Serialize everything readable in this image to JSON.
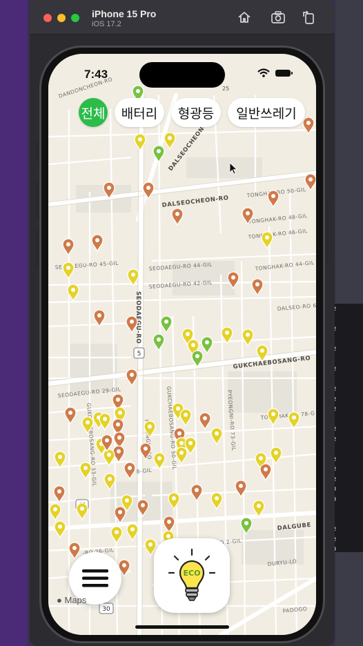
{
  "simulator": {
    "device_name": "iPhone 15 Pro",
    "os_version": "iOS 17.2",
    "toolbar_icons": [
      "home-icon",
      "screenshot-icon",
      "rotate-icon"
    ]
  },
  "status_bar": {
    "time": "7:43"
  },
  "filters": {
    "items": [
      {
        "label": "전체",
        "active": true
      },
      {
        "label": "배터리",
        "active": false
      },
      {
        "label": "형광등",
        "active": false
      },
      {
        "label": "일반쓰레기",
        "active": false
      }
    ]
  },
  "map": {
    "attribution": "Maps",
    "road_labels": {
      "dalseocheon": "DALSEOCHEON-RO",
      "dalseocheon2": "DALSEOCHEON-RO",
      "seodaegu": "SEODAEGU-RO",
      "gukchae": "GUKCHAEBOSANG-RO",
      "dalgubeol": "DALGUBE",
      "tonghak50": "TONGHAK-RO 50-GIL",
      "tonghak48": "TONGHAK-RO 48-GIL",
      "tonghak46": "TONGHAK-RO 46-GIL",
      "tonghak": "TONGHAK-RO 44-GIL",
      "seodaegu45": "SEODAEGU-RO 45-GIL",
      "seodaegu44": "SEODAEGU-RO 44-GIL",
      "seodaegu42": "SEODAEGU-RO 42-GIL",
      "seodaegu29": "SEODAEGU-RO 29-GIL",
      "dalseo": "DALSEO-RO 6",
      "pyeongni73": "PYEONGNI-RO 73-GIL",
      "pyeongni": "PYEONGNI-RO",
      "gukchae50": "GUKCHAEBOSANG-RO 50-GIL",
      "gukchae33": "GUKCHAEBOSANG-RO 33-GIL",
      "durydong": "DURYU-LO",
      "padogo": "PADOGO",
      "dandoncheon": "DANDONCHEON-RO",
      "tonghak78": "TONGHAK-RO 78-G",
      "ro2": "-RO 2-GIL",
      "ro26": "-RO 26-GIL",
      "ro8": "8-GIL",
      "shield5": "5",
      "shield30": "30",
      "shield_top": "25",
      "shield_left": "49"
    },
    "pin_colors": {
      "battery": "#e5d229",
      "fluorescent": "#cf7a4a",
      "general": "#79c142"
    }
  },
  "buttons": {
    "menu_icon": "hamburger-menu-icon",
    "eco_label": "ECO",
    "eco_icon": "lightbulb-icon"
  },
  "terminal": {
    "lines": [
      "de",
      "\\",
      "de",
      "\\",
      "de",
      "\\",
      "de",
      "\\",
      "de",
      "de",
      "de",
      "\\",
      "de",
      "de",
      "\\",
      "de",
      "de",
      "de",
      "ub",
      "ub",
      "bj",
      "bj",
      "je",
      "de",
      "ub",
      "\\",
      "de",
      "ub"
    ]
  }
}
